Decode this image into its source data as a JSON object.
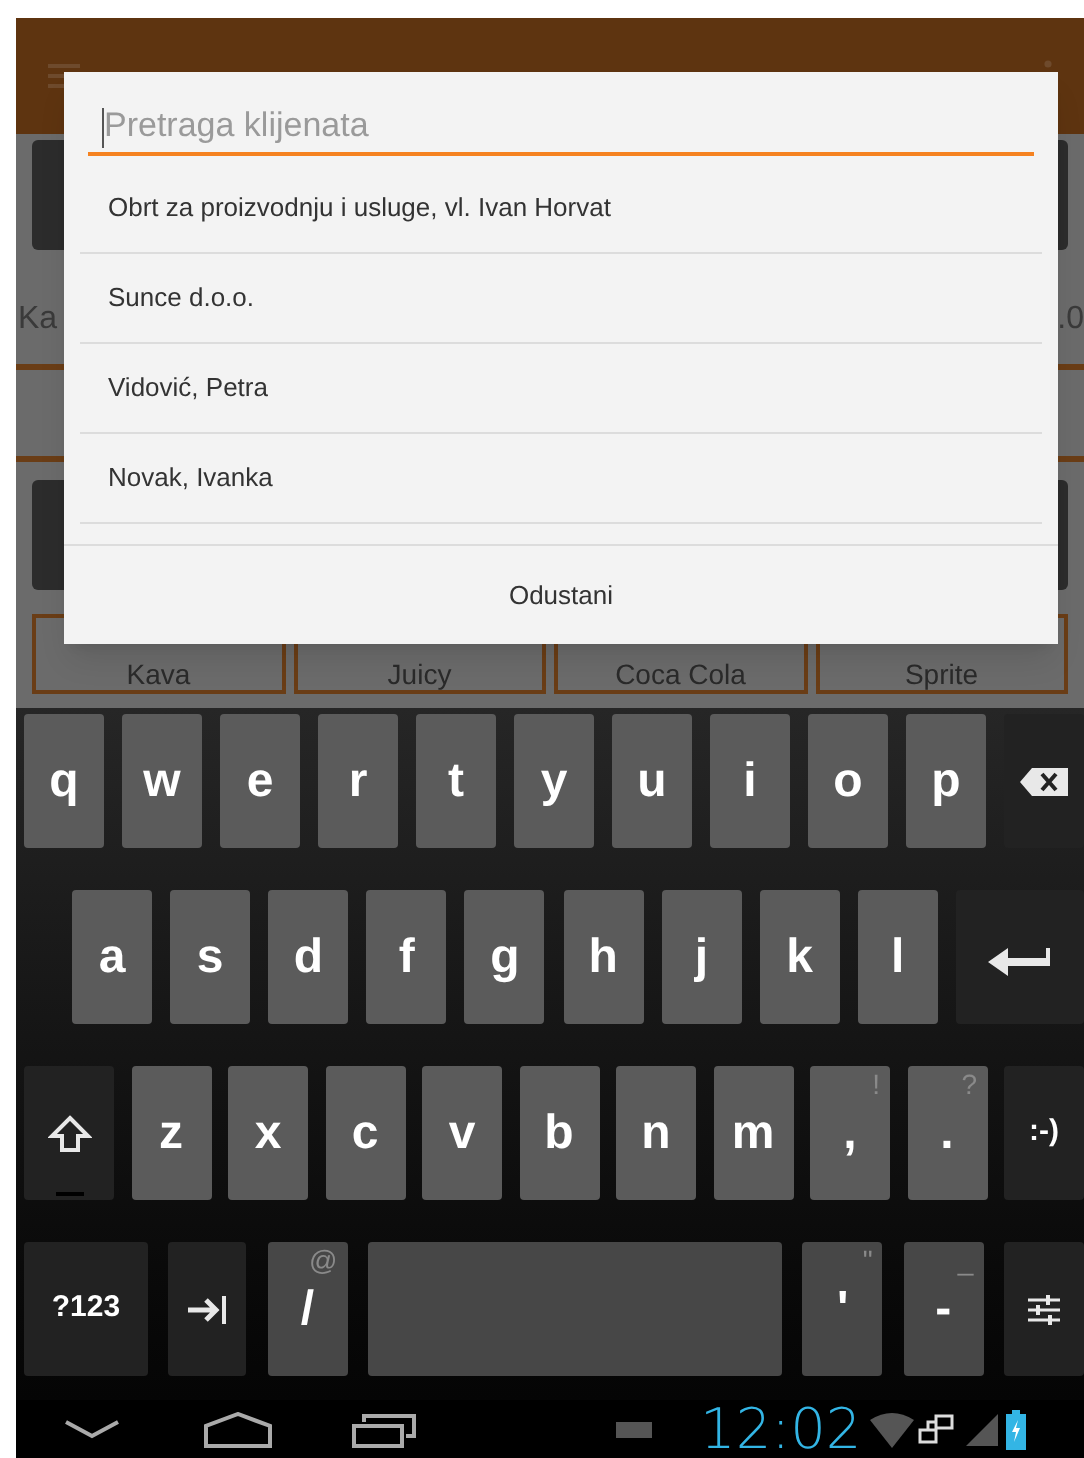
{
  "background": {
    "field_label": "Ka",
    "field_value": ".0",
    "products": [
      "Kava",
      "Juicy",
      "Coca Cola",
      "Sprite"
    ]
  },
  "dialog": {
    "search": {
      "placeholder": "Pretraga klijenata"
    },
    "clients": [
      "Obrt za proizvodnju i usluge, vl. Ivan Horvat",
      "Sunce d.o.o.",
      "Vidović, Petra",
      "Novak, Ivanka"
    ],
    "cancel_button": "Odustani"
  },
  "keyboard": {
    "rows": [
      {
        "keys": [
          {
            "kind": "letter",
            "label": "q"
          },
          {
            "kind": "letter",
            "label": "w"
          },
          {
            "kind": "letter",
            "label": "e"
          },
          {
            "kind": "letter",
            "label": "r"
          },
          {
            "kind": "letter",
            "label": "t"
          },
          {
            "kind": "letter",
            "label": "y"
          },
          {
            "kind": "letter",
            "label": "u"
          },
          {
            "kind": "letter",
            "label": "i"
          },
          {
            "kind": "letter",
            "label": "o"
          },
          {
            "kind": "letter",
            "label": "p"
          },
          {
            "kind": "backspace"
          }
        ]
      },
      {
        "keys": [
          {
            "kind": "letter",
            "label": "a"
          },
          {
            "kind": "letter",
            "label": "s"
          },
          {
            "kind": "letter",
            "label": "d"
          },
          {
            "kind": "letter",
            "label": "f"
          },
          {
            "kind": "letter",
            "label": "g"
          },
          {
            "kind": "letter",
            "label": "h"
          },
          {
            "kind": "letter",
            "label": "j"
          },
          {
            "kind": "letter",
            "label": "k"
          },
          {
            "kind": "letter",
            "label": "l"
          },
          {
            "kind": "enter"
          }
        ]
      },
      {
        "keys": [
          {
            "kind": "shift"
          },
          {
            "kind": "letter",
            "label": "z"
          },
          {
            "kind": "letter",
            "label": "x"
          },
          {
            "kind": "letter",
            "label": "c"
          },
          {
            "kind": "letter",
            "label": "v"
          },
          {
            "kind": "letter",
            "label": "b"
          },
          {
            "kind": "letter",
            "label": "n"
          },
          {
            "kind": "letter",
            "label": "m"
          },
          {
            "kind": "letter",
            "label": ",",
            "hint": "!"
          },
          {
            "kind": "letter",
            "label": ".",
            "hint": "?"
          },
          {
            "kind": "function",
            "label": ":-)"
          }
        ]
      },
      {
        "keys": [
          {
            "kind": "symbols",
            "label": "?123"
          },
          {
            "kind": "tab"
          },
          {
            "kind": "letter",
            "label": "/",
            "hint": "@"
          },
          {
            "kind": "space"
          },
          {
            "kind": "letter",
            "label": "'",
            "hint": "\""
          },
          {
            "kind": "letter",
            "label": "-",
            "hint": "_"
          },
          {
            "kind": "settings"
          }
        ]
      }
    ]
  },
  "status_bar": {
    "time": "12:02"
  }
}
